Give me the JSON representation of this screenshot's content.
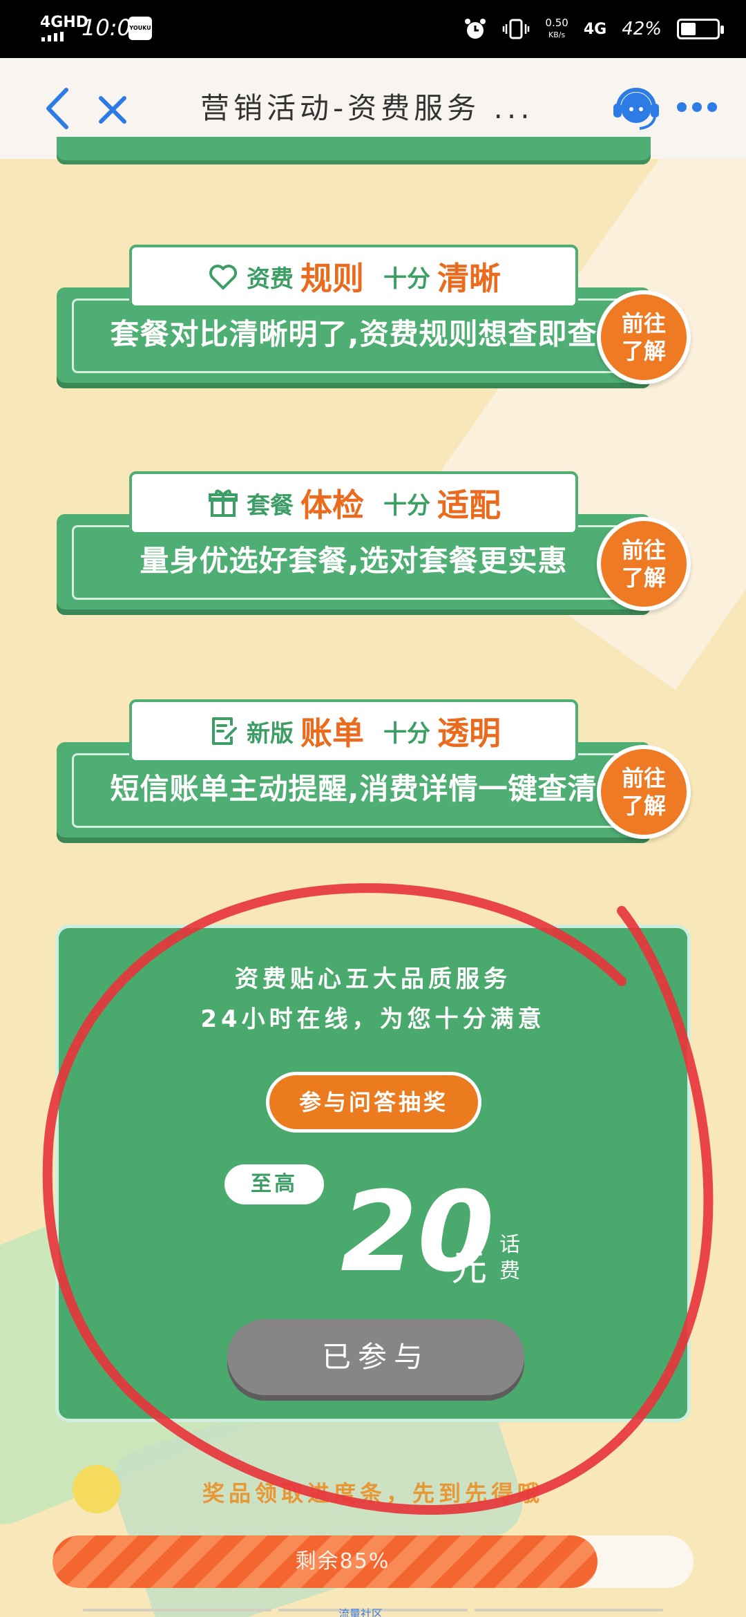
{
  "status_bar": {
    "network": "4GHD",
    "time": "10:03",
    "app_icon": "YOUKU",
    "speed_value": "0.50",
    "speed_unit": "KB/s",
    "mobile": "4G",
    "battery": "42%",
    "battery_level": 0.42
  },
  "nav": {
    "title": "营销活动-资费服务 ...",
    "icons": [
      "back-icon",
      "close-icon",
      "customer-service-icon",
      "more-icon"
    ]
  },
  "features": [
    {
      "icon": "heart-icon",
      "prefix": "资费",
      "keyword": "规则",
      "middle": "十分",
      "highlight": "清晰",
      "description": "套餐对比清晰明了,资费规则想查即查",
      "button": "前往\n了解"
    },
    {
      "icon": "gift-icon",
      "prefix": "套餐",
      "keyword": "体检",
      "middle": "十分",
      "highlight": "适配",
      "description": "量身优选好套餐,选对套餐更实惠",
      "button": "前往\n了解"
    },
    {
      "icon": "bill-icon",
      "prefix": "新版",
      "keyword": "账单",
      "middle": "十分",
      "highlight": "透明",
      "description": "短信账单主动提醒,消费详情一键查清",
      "button": "前往\n了解"
    }
  ],
  "lottery": {
    "line1": "资费贴心五大品质服务",
    "line2": "24小时在线，为您十分满意",
    "join_button": "参与问答抽奖",
    "max_label": "至高",
    "amount": "20",
    "unit": "元",
    "note": "话费",
    "status_button": "已参与"
  },
  "progress": {
    "caption": "奖品领取进度条，先到先得哦",
    "label": "剩余85%",
    "fill_fraction": 0.85
  },
  "bottom": {
    "label": "流量社区"
  },
  "colors": {
    "green": "#4fae73",
    "orange": "#ee7b23",
    "background": "#f7e7b9",
    "annotation_red": "#e8333a"
  }
}
